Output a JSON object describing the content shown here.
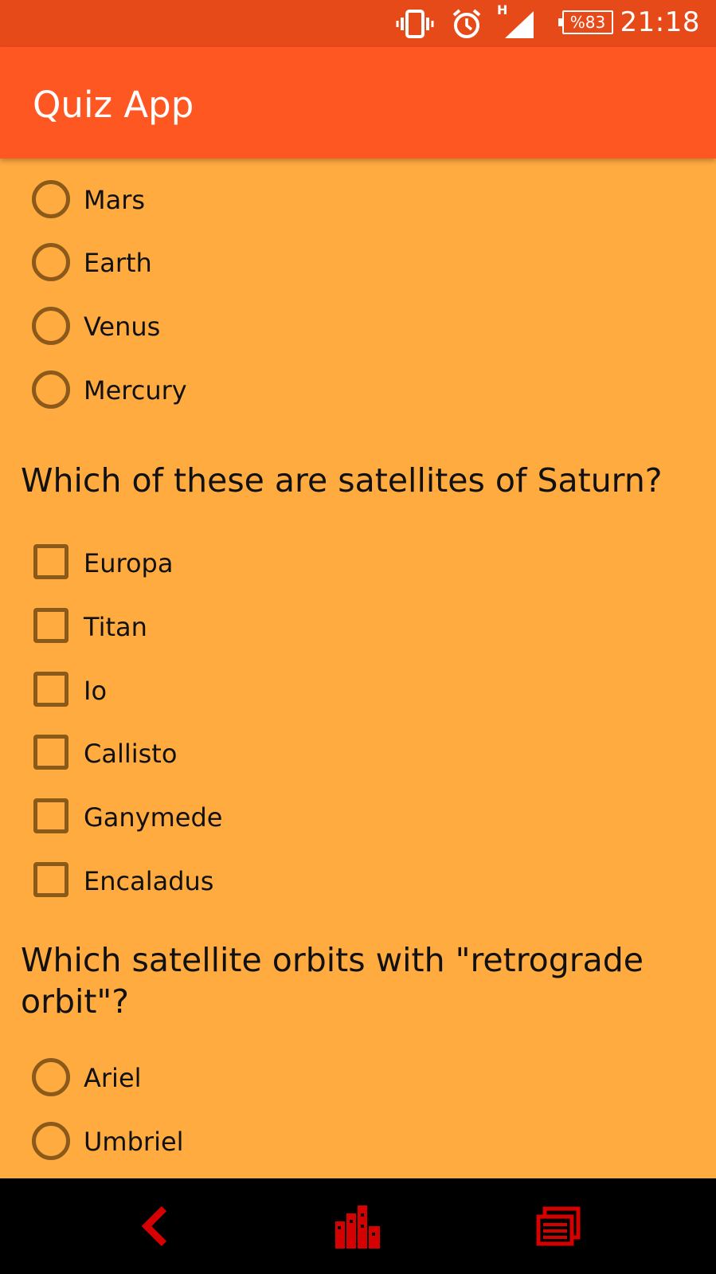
{
  "status_bar": {
    "network_type": "H",
    "battery": "%83",
    "time": "21:18",
    "icons": [
      "vibrate-icon",
      "alarm-icon",
      "signal-icon",
      "battery-icon"
    ]
  },
  "app_bar": {
    "title": "Quiz App"
  },
  "colors": {
    "status_bar": "#E64A19",
    "app_bar": "#FF5722",
    "background": "#FFAB40",
    "control": "#8B5A1A",
    "nav_icons": "#D50000"
  },
  "question_planet": {
    "options": [
      {
        "label": "Mars",
        "checked": false
      },
      {
        "label": "Earth",
        "checked": false
      },
      {
        "label": "Venus",
        "checked": false
      },
      {
        "label": "Mercury",
        "checked": false
      }
    ]
  },
  "question_saturn": {
    "text": "Which of these are satellites of Saturn?",
    "options": [
      {
        "label": "Europa",
        "checked": false
      },
      {
        "label": "Titan",
        "checked": false
      },
      {
        "label": "Io",
        "checked": false
      },
      {
        "label": "Callisto",
        "checked": false
      },
      {
        "label": "Ganymede",
        "checked": false
      },
      {
        "label": "Encaladus",
        "checked": false
      }
    ]
  },
  "question_retrograde": {
    "text": "Which satellite orbits with \"retrograde orbit\"?",
    "options": [
      {
        "label": "Ariel",
        "checked": false
      },
      {
        "label": "Umbriel",
        "checked": false
      }
    ]
  },
  "nav_bar": {
    "icons": [
      "back-icon",
      "home-icon",
      "recents-icon"
    ]
  }
}
